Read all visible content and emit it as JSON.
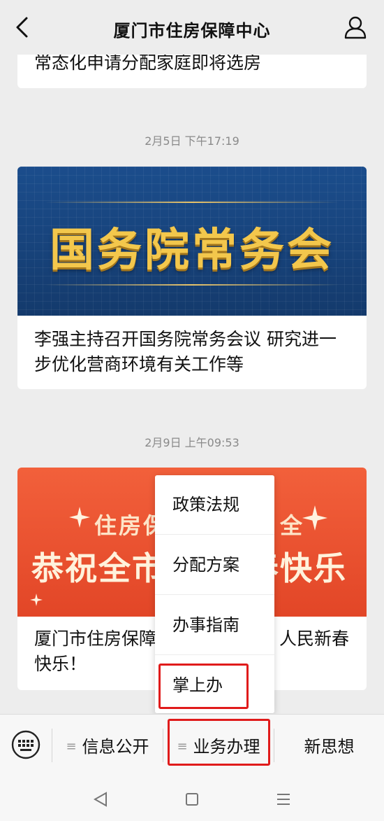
{
  "header": {
    "title": "厦门市住房保障中心",
    "back_icon": "chevron-left-icon",
    "profile_icon": "user-icon"
  },
  "feed": {
    "top_card_caption": "常态化申请分配家庭即将选房",
    "post1": {
      "time": "2月5日 下午17:19",
      "banner_text": "国务院常务会",
      "caption": "李强主持召开国务院常务会议 研究进一步优化营商环境有关工作等"
    },
    "post2": {
      "time": "2月9日 上午09:53",
      "banner_sub_left": "住房保",
      "banner_sub_right": "全",
      "banner_big_left": "恭祝全市",
      "banner_big_right": "春快乐",
      "caption_left": "厦门市住房保障",
      "caption_right": "人民新春",
      "caption_line2": "快乐！"
    }
  },
  "popup_menu": {
    "items": [
      "政策法规",
      "分配方案",
      "办事指南",
      "掌上办"
    ],
    "highlighted": "掌上办"
  },
  "menubar": {
    "keyboard_icon": "keyboard-icon",
    "tabs": [
      "信息公开",
      "业务办理",
      "新思想"
    ],
    "highlighted": "业务办理"
  },
  "system_nav": {
    "icons": [
      "back-triangle-icon",
      "home-square-icon",
      "menu-lines-icon"
    ]
  },
  "colors": {
    "highlight_box": "#e01b1b",
    "banner_blue": "#17437c",
    "banner_gold": "#f3c74c",
    "banner_red": "#e24627"
  }
}
